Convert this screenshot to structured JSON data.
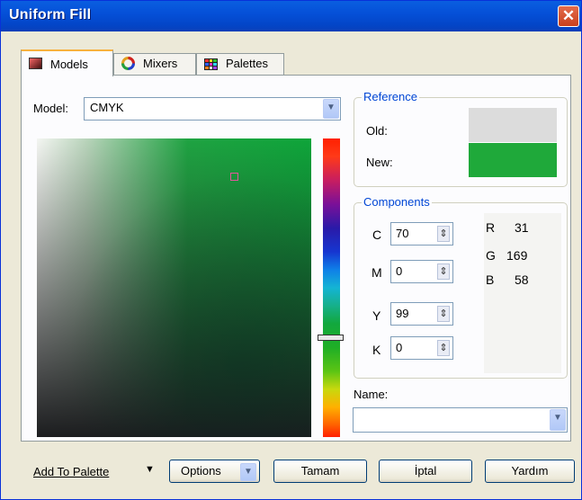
{
  "window": {
    "title": "Uniform Fill",
    "close_label": "✕"
  },
  "tabs": [
    {
      "label": "Models",
      "icon": "models-icon",
      "active": true
    },
    {
      "label": "Mixers",
      "icon": "mixers-icon",
      "active": false
    },
    {
      "label": "Palettes",
      "icon": "palettes-icon",
      "active": false
    }
  ],
  "model": {
    "label": "Model:",
    "value": "CMYK"
  },
  "reference": {
    "title": "Reference",
    "old_label": "Old:",
    "new_label": "New:",
    "old_color": "#dcdcdc",
    "new_color": "#1fa93a"
  },
  "components": {
    "title": "Components",
    "fields": [
      {
        "label": "C",
        "value": "70"
      },
      {
        "label": "M",
        "value": "0"
      },
      {
        "label": "Y",
        "value": "99"
      },
      {
        "label": "K",
        "value": "0"
      }
    ],
    "rgb": [
      {
        "label": "R",
        "value": "31"
      },
      {
        "label": "G",
        "value": "169"
      },
      {
        "label": "B",
        "value": "58"
      }
    ]
  },
  "name_field": {
    "label": "Name:",
    "value": ""
  },
  "footer": {
    "add_to_palette": "Add To Palette",
    "options": "Options",
    "ok": "Tamam",
    "cancel": "İptal",
    "help": "Yardım"
  },
  "colors": {
    "title_bar": "#0550d8",
    "group_title": "#0046d5",
    "tab_highlight": "#f7b13e"
  }
}
